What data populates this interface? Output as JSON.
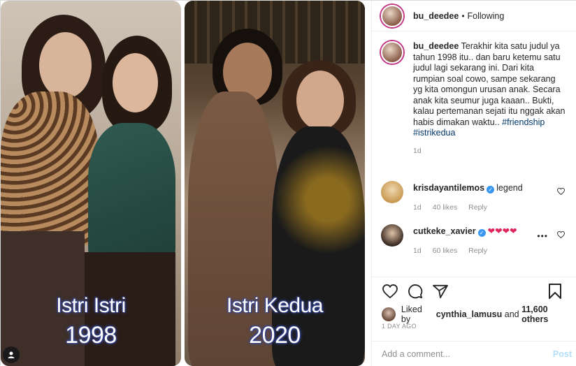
{
  "media": {
    "left_caption_line1": "Istri Istri",
    "left_caption_line2": "1998",
    "right_caption_line1": "Istri Kedua",
    "right_caption_line2": "2020"
  },
  "header": {
    "username": "bu_deedee",
    "separator": "•",
    "follow_status": "Following"
  },
  "caption": {
    "username": "bu_deedee",
    "text": "Terakhir kita satu judul ya tahun 1998 itu.. dan baru ketemu satu judul lagi sekarang ini. Dari kita rumpian soal cowo, sampe sekarang yg kita omongun urusan anak. Secara anak kita seumur juga kaaan.. Bukti, kalau pertemanan sejati itu nggak akan habis dimakan waktu..",
    "hashtags": "#friendship #istrikedua",
    "time": "1d"
  },
  "comments": [
    {
      "username": "krisdayantilemos",
      "text": "legend",
      "time": "1d",
      "likes": "40 likes",
      "reply": "Reply"
    },
    {
      "username": "cutkeke_xavier",
      "text": "❤❤❤❤",
      "time": "1d",
      "likes": "60 likes",
      "reply": "Reply",
      "more": "•••"
    }
  ],
  "likes": {
    "prefix": "Liked by",
    "user": "cynthia_lamusu",
    "conj": "and",
    "count": "11,600 others"
  },
  "posted_ago": "1 DAY AGO",
  "add_comment": {
    "placeholder": "Add a comment...",
    "post_label": "Post"
  },
  "colors": {
    "link": "#00376b",
    "muted": "#8e8e8e",
    "post_disabled": "#b2dffc",
    "verified": "#3897f0",
    "heart": "#e0245e",
    "caption_glow": "#3a4a9a"
  }
}
